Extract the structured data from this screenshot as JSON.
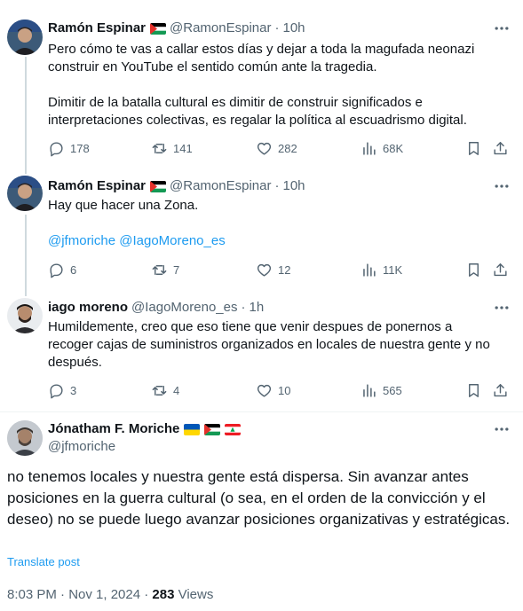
{
  "tweets": [
    {
      "name": "Ramón Espinar",
      "handle": "@RamonEspinar",
      "time": "10h",
      "text": "Pero cómo te vas a callar estos días y dejar a toda la magufada neonazi construir en YouTube el sentido común ante la tragedia.\n\nDimitir de la batalla cultural es dimitir de construir significados e interpretaciones colectivas, es regalar la política al escuadrismo digital.",
      "replies": "178",
      "retweets": "141",
      "likes": "282",
      "views": "68K"
    },
    {
      "name": "Ramón Espinar",
      "handle": "@RamonEspinar",
      "time": "10h",
      "text": "Hay que hacer una Zona.",
      "mentions": "@jfmoriche @IagoMoreno_es",
      "replies": "6",
      "retweets": "7",
      "likes": "12",
      "views": "11K"
    },
    {
      "name": "iago moreno",
      "handle": "@IagoMoreno_es",
      "time": "1h",
      "text": "Humildemente, creo que eso tiene que venir despues de ponernos a recoger cajas de suministros organizados en locales de nuestra gente y no después.",
      "replies": "3",
      "retweets": "4",
      "likes": "10",
      "views": "565"
    }
  ],
  "main": {
    "name": "Jónatham F. Moriche",
    "handle": "@jfmoriche",
    "text": "no tenemos locales y nuestra gente está dispersa. Sin avanzar antes posiciones en la guerra cultural (o sea, en el orden de la convicción y el deseo) no se puede luego avanzar posiciones organizativas y estratégicas.",
    "translate": "Translate post",
    "date": "8:03 PM · Nov 1, 2024 · ",
    "views_count": "283",
    "views_label": " Views"
  },
  "dot": "·",
  "colors": {
    "text": "#0f1419",
    "secondary": "#536471",
    "link": "#1d9bf0",
    "line": "#cfd9de"
  }
}
